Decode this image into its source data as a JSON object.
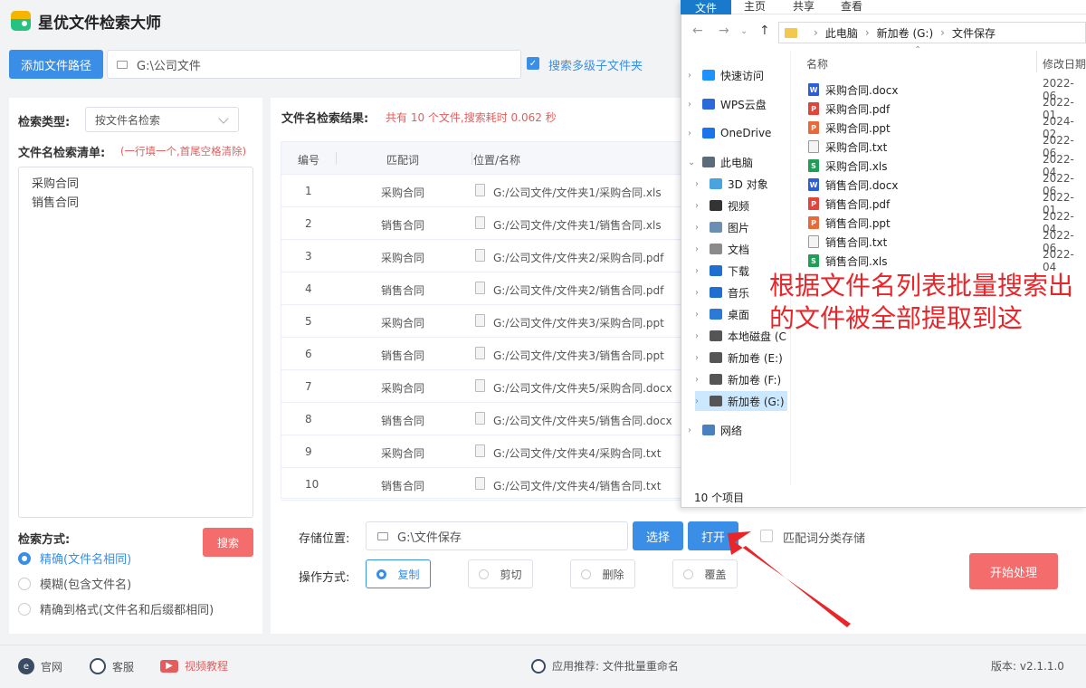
{
  "app": {
    "title": "星优文件检索大师"
  },
  "top": {
    "add_path_label": "添加文件路径",
    "path_value": "G:\\公司文件",
    "subfolder_label": "搜索多级子文件夹"
  },
  "left": {
    "search_type_label": "检索类型:",
    "search_type_value": "按文件名检索",
    "list_label": "文件名检索清单:",
    "list_hint": "(一行填一个,首尾空格清除)",
    "list_lines": [
      "采购合同",
      "销售合同"
    ],
    "mode_label": "检索方式:",
    "search_button": "搜索",
    "modes": [
      "精确(文件名相同)",
      "模糊(包含文件名)",
      "精确到格式(文件名和后缀都相同)"
    ]
  },
  "results": {
    "label": "文件名检索结果:",
    "summary": "共有 10 个文件,搜索耗时 0.062 秒",
    "headers": [
      "编号",
      "匹配词",
      "位置/名称"
    ],
    "rows": [
      {
        "num": "1",
        "word": "采购合同",
        "path": "G:/公司文件/文件夹1/采购合同.xls"
      },
      {
        "num": "2",
        "word": "销售合同",
        "path": "G:/公司文件/文件夹1/销售合同.xls"
      },
      {
        "num": "3",
        "word": "采购合同",
        "path": "G:/公司文件/文件夹2/采购合同.pdf"
      },
      {
        "num": "4",
        "word": "销售合同",
        "path": "G:/公司文件/文件夹2/销售合同.pdf"
      },
      {
        "num": "5",
        "word": "采购合同",
        "path": "G:/公司文件/文件夹3/采购合同.ppt"
      },
      {
        "num": "6",
        "word": "销售合同",
        "path": "G:/公司文件/文件夹3/销售合同.ppt"
      },
      {
        "num": "7",
        "word": "采购合同",
        "path": "G:/公司文件/文件夹5/采购合同.docx"
      },
      {
        "num": "8",
        "word": "销售合同",
        "path": "G:/公司文件/文件夹5/销售合同.docx"
      },
      {
        "num": "9",
        "word": "采购合同",
        "path": "G:/公司文件/文件夹4/采购合同.txt"
      },
      {
        "num": "10",
        "word": "销售合同",
        "path": "G:/公司文件/文件夹4/销售合同.txt"
      }
    ]
  },
  "controls": {
    "storage_label": "存储位置:",
    "storage_value": "G:\\文件保存",
    "choose_button": "选择",
    "open_button": "打开",
    "classify_label": "匹配词分类存储",
    "op_label": "操作方式:",
    "ops": [
      "复制",
      "剪切",
      "删除",
      "覆盖"
    ],
    "start_button": "开始处理"
  },
  "footer": {
    "website": "官网",
    "service": "客服",
    "video": "视频教程",
    "recommend": "应用推荐:  文件批量重命名",
    "version": "版本:  v2.1.1.0"
  },
  "explorer": {
    "ribbon_tabs": [
      "文件",
      "主页",
      "共享",
      "查看"
    ],
    "breadcrumb": [
      "此电脑",
      "新加卷 (G:)",
      "文件保存"
    ],
    "col_name": "名称",
    "col_date": "修改日期",
    "nav": [
      "快速访问",
      "WPS云盘",
      "OneDrive",
      "此电脑",
      "3D 对象",
      "视频",
      "图片",
      "文档",
      "下载",
      "音乐",
      "桌面",
      "本地磁盘 (C",
      "新加卷 (E:)",
      "新加卷 (F:)",
      "新加卷 (G:)",
      "网络"
    ],
    "files": [
      {
        "name": "采购合同.docx",
        "date": "2022-06",
        "color": "#2b5fd9",
        "tag": "W"
      },
      {
        "name": "采购合同.pdf",
        "date": "2022-01",
        "color": "#e0443a",
        "tag": "P"
      },
      {
        "name": "采购合同.ppt",
        "date": "2024-02",
        "color": "#e86a3a",
        "tag": "P"
      },
      {
        "name": "采购合同.txt",
        "date": "2022-06",
        "color": "#9a9a9a",
        "tag": ""
      },
      {
        "name": "采购合同.xls",
        "date": "2022-04",
        "color": "#1f9e55",
        "tag": "S"
      },
      {
        "name": "销售合同.docx",
        "date": "2022-06",
        "color": "#2b5fd9",
        "tag": "W"
      },
      {
        "name": "销售合同.pdf",
        "date": "2022-01",
        "color": "#e0443a",
        "tag": "P"
      },
      {
        "name": "销售合同.ppt",
        "date": "2022-04",
        "color": "#e86a3a",
        "tag": "P"
      },
      {
        "name": "销售合同.txt",
        "date": "2022-06",
        "color": "#9a9a9a",
        "tag": ""
      },
      {
        "name": "销售合同.xls",
        "date": "2022-04",
        "color": "#1f9e55",
        "tag": "S"
      }
    ],
    "item_count": "10 个项目"
  },
  "annotation": {
    "text": "根据文件名列表批量搜索出的文件被全部提取到这"
  }
}
